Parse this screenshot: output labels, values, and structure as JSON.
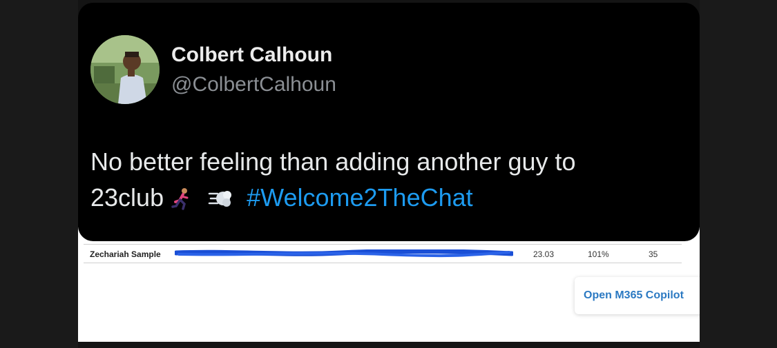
{
  "tweet": {
    "display_name": "Colbert Calhoun",
    "handle": "@ColbertCalhoun",
    "text_line1": "No better feeling than adding another guy to",
    "text_line2_prefix": "23club",
    "hashtag": "#Welcome2TheChat",
    "emojis": [
      "running-person-icon",
      "dash-icon"
    ],
    "hashtag_color": "#1d9bf0"
  },
  "sheet": {
    "row": {
      "name": "Zechariah Sample",
      "value1": "23.03",
      "value2": "101%",
      "value3": "35"
    }
  },
  "copilot": {
    "label": "Open M365 Copilot"
  }
}
